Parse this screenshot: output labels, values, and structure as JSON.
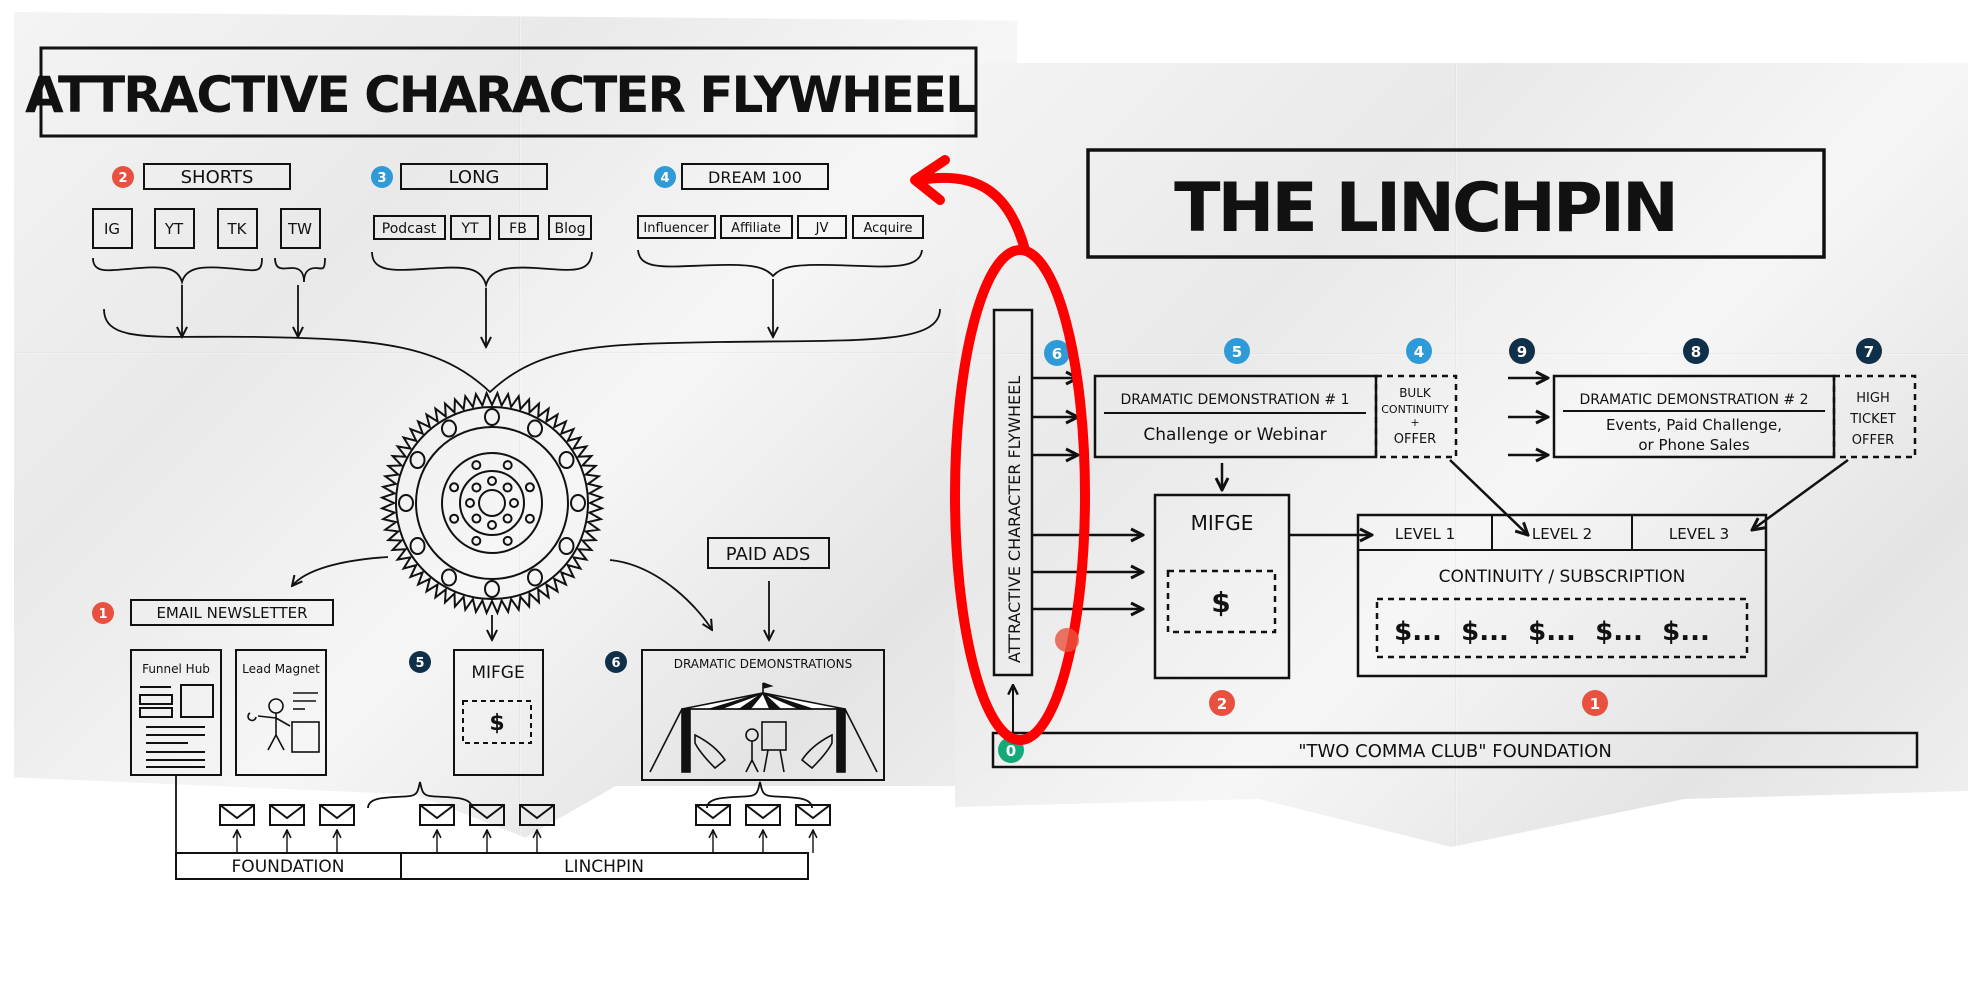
{
  "left_panel": {
    "title": "ATTRACTIVE CHARACTER FLYWHEEL",
    "groups": [
      {
        "badge": "2",
        "badge_color": "#e8513f",
        "label": "SHORTS",
        "items": [
          "IG",
          "YT",
          "TK",
          "TW"
        ]
      },
      {
        "badge": "3",
        "badge_color": "#2f9ad8",
        "label": "LONG",
        "items": [
          "Podcast",
          "YT",
          "FB",
          "Blog"
        ]
      },
      {
        "badge": "4",
        "badge_color": "#2f9ad8",
        "label": "DREAM 100",
        "items": [
          "Influencer",
          "Affiliate",
          "JV",
          "Acquire"
        ]
      }
    ],
    "flywheel_icon": "flywheel-gear-icon",
    "email": {
      "badge": "1",
      "badge_color": "#e8513f",
      "label": "EMAIL NEWSLETTER",
      "cards": [
        "Funnel Hub",
        "Lead Magnet"
      ]
    },
    "mifge": {
      "badge": "5",
      "badge_color": "#10304a",
      "label": "MIFGE",
      "symbol": "$"
    },
    "demos": {
      "badge": "6",
      "badge_color": "#10304a",
      "label": "DRAMATIC DEMONSTRATIONS",
      "feeder": "PAID ADS"
    },
    "bottom_bar": {
      "left": "FOUNDATION",
      "right": "LINCHPIN"
    }
  },
  "right_panel": {
    "title": "THE LINCHPIN",
    "vertical_label": "ATTRACTIVE CHARACTER FLYWHEEL",
    "badges_top": [
      {
        "n": "6",
        "color": "#2f9ad8"
      },
      {
        "n": "5",
        "color": "#2f9ad8"
      },
      {
        "n": "4",
        "color": "#2f9ad8"
      },
      {
        "n": "9",
        "color": "#10304a"
      },
      {
        "n": "8",
        "color": "#10304a"
      },
      {
        "n": "7",
        "color": "#10304a"
      }
    ],
    "dd1": {
      "heading": "DRAMATIC DEMONSTRATION # 1",
      "body": "Challenge or Webinar"
    },
    "bulk_offer": [
      "BULK",
      "CONTINUITY",
      "+",
      "OFFER"
    ],
    "dd2": {
      "heading": "DRAMATIC DEMONSTRATION # 2",
      "body_line1": "Events, Paid Challenge,",
      "body_line2": "or Phone Sales"
    },
    "high_ticket": [
      "HIGH",
      "TICKET",
      "OFFER"
    ],
    "mifge": {
      "label": "MIFGE",
      "symbol": "$",
      "badge": "2",
      "badge_color": "#e8513f"
    },
    "continuity": {
      "levels": [
        "LEVEL 1",
        "LEVEL 2",
        "LEVEL 3"
      ],
      "label": "CONTINUITY / SUBSCRIPTION",
      "payments": [
        "$...",
        "$...",
        "$...",
        "$...",
        "$..."
      ],
      "badge": "1",
      "badge_color": "#e8513f"
    },
    "foundation": {
      "badge": "0",
      "badge_color": "#15a97a",
      "label": "\"TWO COMMA CLUB\" FOUNDATION"
    }
  },
  "annotation": {
    "color": "#ff0000",
    "shape": "ellipse-with-curved-arrow"
  }
}
